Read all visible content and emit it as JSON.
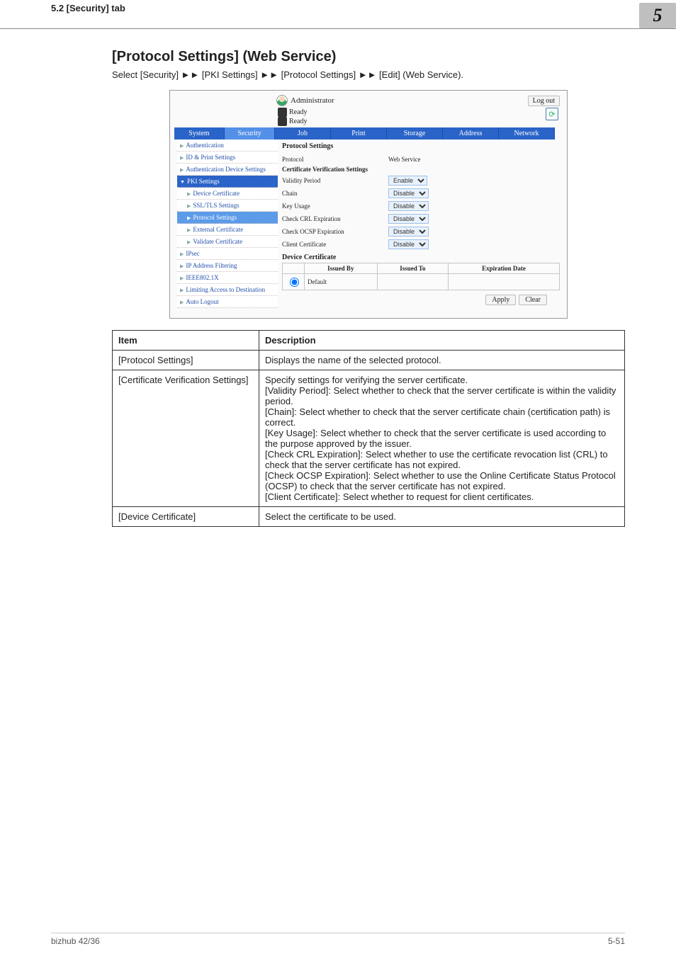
{
  "page_header": {
    "left": "5.2        [Security] tab",
    "right": "5"
  },
  "section_title": "[Protocol Settings] (Web Service)",
  "breadcrumb_text": "Select [Security] ►► [PKI Settings] ►► [Protocol Settings] ►► [Edit] (Web Service).",
  "shot": {
    "admin_label": "Administrator",
    "logout": "Log out",
    "ready1": "Ready",
    "ready2": "Ready",
    "tabs": [
      "System",
      "Security",
      "Job",
      "Print",
      "Storage",
      "Address",
      "Network"
    ],
    "nav": [
      "Authentication",
      "ID & Print Settings",
      "Authentication Device Settings",
      "PKI Settings",
      "Device Certificate",
      "SSL/TLS Settings",
      "Protocol Settings",
      "External Certificate",
      "Validate Certificate",
      "IPsec",
      "IP Address Filtering",
      "IEEE802.1X",
      "Limiting Access to Destination",
      "Auto Logout"
    ],
    "panel": {
      "heading": "Protocol Settings",
      "proto_label": "Protocol",
      "proto_value": "Web Service",
      "cvs_label": "Certificate Verification Settings",
      "rows": [
        {
          "k": "Validity Period",
          "v": "Enable"
        },
        {
          "k": "Chain",
          "v": "Disable"
        },
        {
          "k": "Key Usage",
          "v": "Disable"
        },
        {
          "k": "Check CRL Expiration",
          "v": "Disable"
        },
        {
          "k": "Check OCSP Expiration",
          "v": "Disable"
        },
        {
          "k": "Client Certificate",
          "v": "Disable"
        }
      ],
      "devcert_label": "Device Certificate",
      "devcert_headers": [
        "",
        "Issued By",
        "Issued To",
        "Expiration Date"
      ],
      "devcert_row": [
        "Default",
        "",
        ""
      ],
      "apply": "Apply",
      "clear": "Clear"
    }
  },
  "desc_headers": {
    "item": "Item",
    "description": "Description"
  },
  "desc_rows": [
    {
      "item": "[Protocol Settings]",
      "description": "Displays the name of the selected protocol."
    },
    {
      "item": "[Certificate Verification Settings]",
      "description": "Specify settings for verifying the server certificate.\n[Validity Period]: Select whether to check that the server certificate is within the validity period.\n[Chain]: Select whether to check that the server certificate chain (certification path) is correct.\n[Key Usage]: Select whether to check that the server certificate is used according to the purpose approved by the issuer.\n[Check CRL Expiration]: Select whether to use the certificate revocation list (CRL) to check that the server certificate has not expired.\n[Check OCSP Expiration]: Select whether to use the Online Certificate Status Protocol (OCSP) to check that the server certificate has not expired.\n[Client Certificate]: Select whether to request for client certificates."
    },
    {
      "item": "[Device Certificate]",
      "description": "Select the certificate to be used."
    }
  ],
  "footer": {
    "left": "bizhub 42/36",
    "right": "5-51"
  }
}
